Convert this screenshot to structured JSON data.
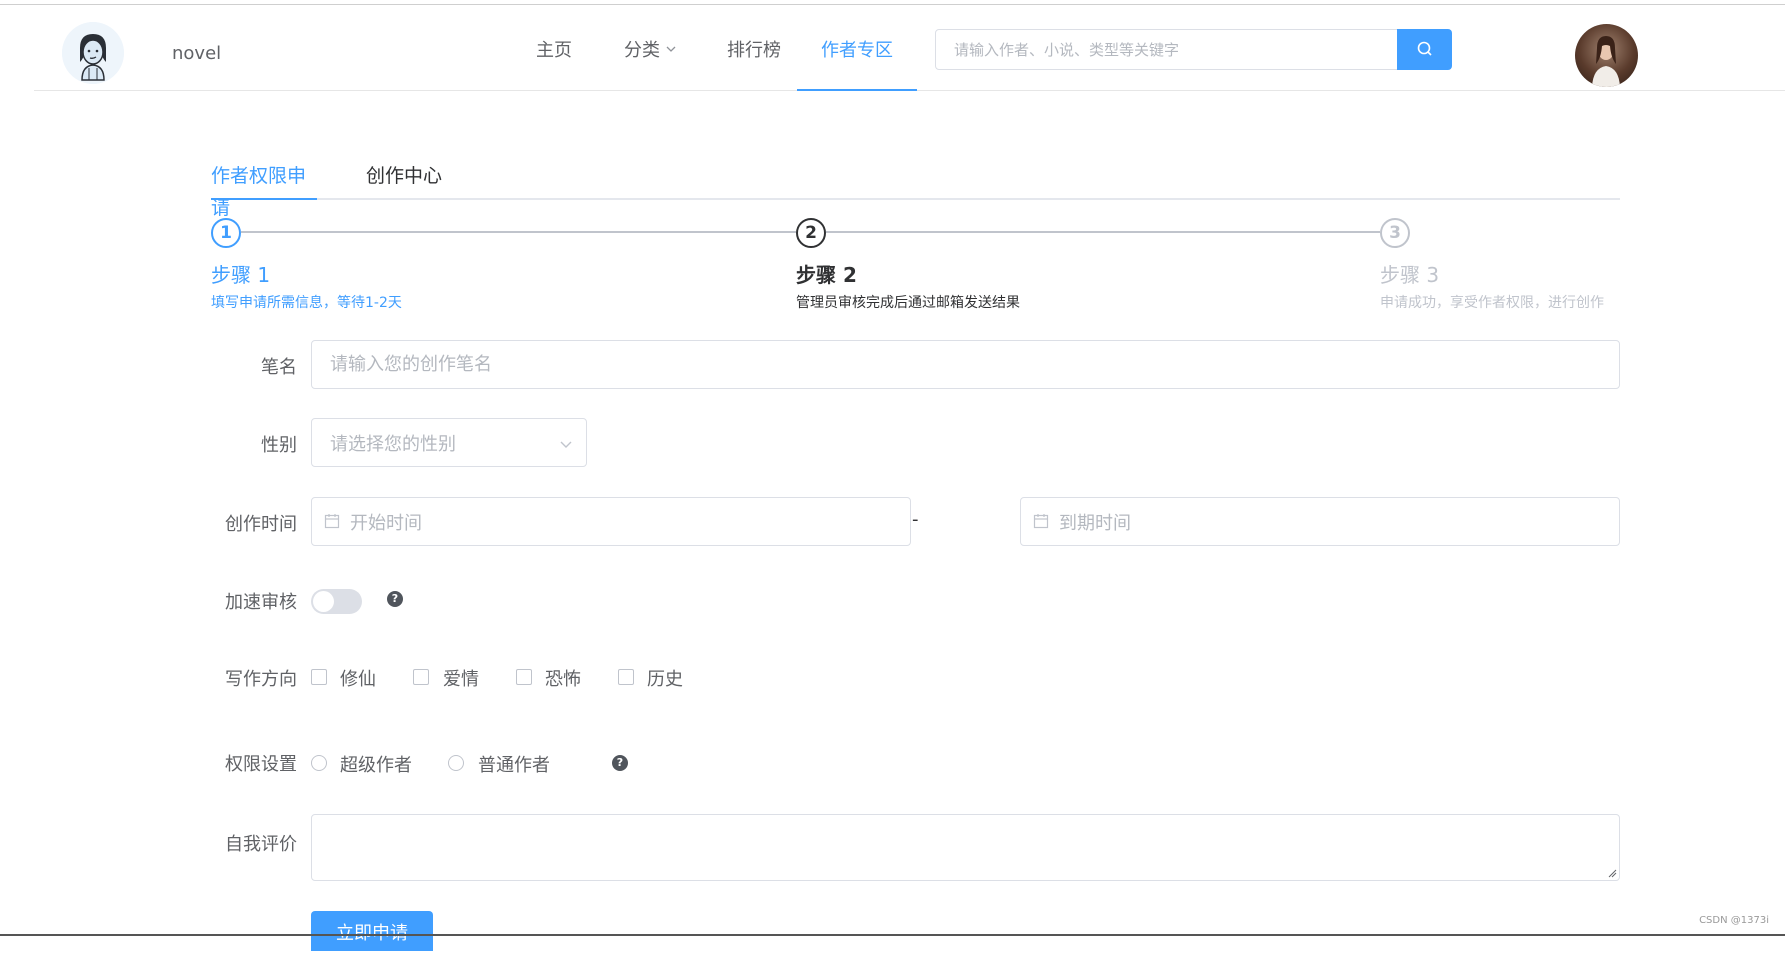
{
  "header": {
    "app_name": "novel",
    "nav": [
      {
        "label": "主页"
      },
      {
        "label": "分类"
      },
      {
        "label": "排行榜"
      },
      {
        "label": "作者专区"
      }
    ],
    "search_placeholder": "请输入作者、小说、类型等关键字",
    "active_nav": "作者专区"
  },
  "tabs": [
    {
      "label": "作者权限申请",
      "active": true
    },
    {
      "label": "创作中心",
      "active": false
    }
  ],
  "steps": [
    {
      "number": "1",
      "title": "步骤 1",
      "description": "填写申请所需信息，等待1-2天",
      "status": "finish"
    },
    {
      "number": "2",
      "title": "步骤 2",
      "description": "管理员审核完成后通过邮箱发送结果",
      "status": "process"
    },
    {
      "number": "3",
      "title": "步骤 3",
      "description": "申请成功，享受作者权限，进行创作",
      "status": "wait"
    }
  ],
  "form": {
    "pen_name": {
      "label": "笔名",
      "placeholder": "请输入您的创作笔名",
      "value": ""
    },
    "gender": {
      "label": "性别",
      "placeholder": "请选择您的性别"
    },
    "creation_time": {
      "label": "创作时间",
      "start_placeholder": "开始时间",
      "separator": "-",
      "end_placeholder": "到期时间"
    },
    "fast_review": {
      "label": "加速审核",
      "enabled": false,
      "help": "?"
    },
    "direction": {
      "label": "写作方向",
      "options": [
        "修仙",
        "爱情",
        "恐怖",
        "历史"
      ]
    },
    "permission": {
      "label": "权限设置",
      "options": [
        "超级作者",
        "普通作者"
      ],
      "help": "?"
    },
    "self_evaluation": {
      "label": "自我评价",
      "value": ""
    },
    "submit_label": "立即申请"
  },
  "watermark": "CSDN @1373i",
  "colors": {
    "accent": "#409eff",
    "text": "#303133",
    "muted": "#606266",
    "placeholder": "#b4b8bf",
    "border": "#dcdfe6"
  }
}
